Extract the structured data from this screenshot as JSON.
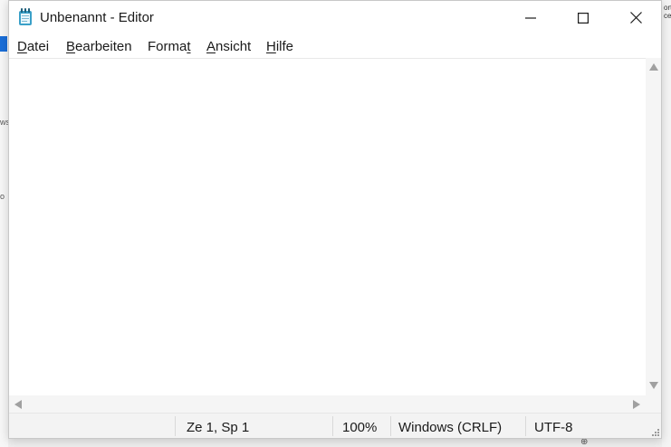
{
  "window": {
    "title": "Unbenannt - Editor"
  },
  "icons": {
    "app": "notepad-icon",
    "minimize": "minimize-icon",
    "maximize": "maximize-icon",
    "close": "close-icon"
  },
  "menu": [
    {
      "label": "Datei",
      "mnemonic_index": 0
    },
    {
      "label": "Bearbeiten",
      "mnemonic_index": 0
    },
    {
      "label": "Format",
      "mnemonic_index": 5
    },
    {
      "label": "Ansicht",
      "mnemonic_index": 0
    },
    {
      "label": "Hilfe",
      "mnemonic_index": 0
    }
  ],
  "editor": {
    "content": ""
  },
  "status": {
    "position": "Ze 1, Sp 1",
    "zoom": "100%",
    "line_ending": "Windows (CRLF)",
    "encoding": "UTF-8"
  },
  "colors": {
    "accent_blue": "#1a6ed8",
    "icon_teal": "#3aa0c8"
  }
}
